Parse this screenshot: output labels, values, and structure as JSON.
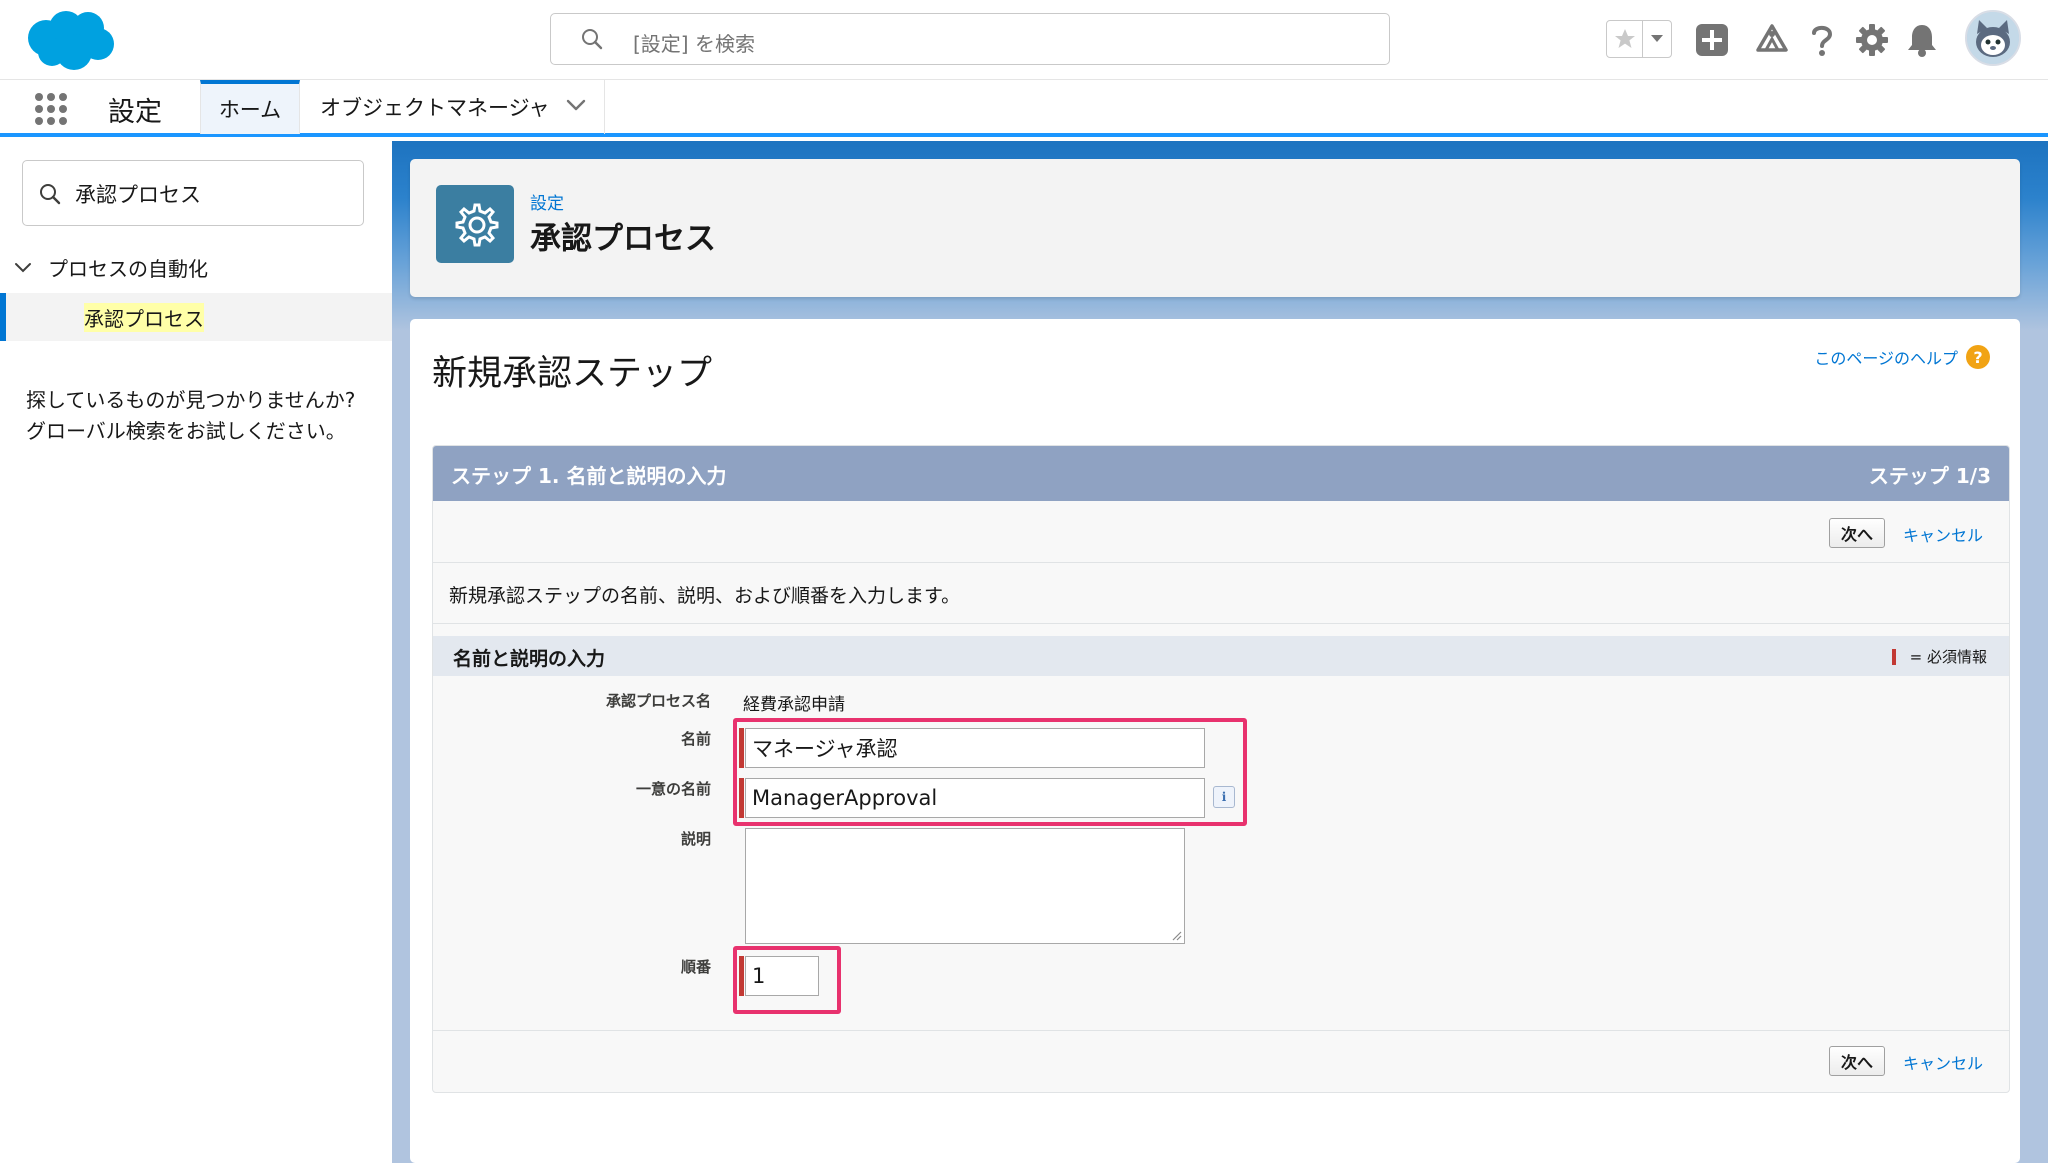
{
  "header": {
    "search_placeholder": "[設定] を検索",
    "brand_color": "#00a1e0"
  },
  "appnav": {
    "app_name": "設定",
    "tabs": [
      {
        "label": "ホーム"
      },
      {
        "label": "オブジェクトマネージャ"
      }
    ]
  },
  "sidebar": {
    "search_value": "承認プロセス",
    "group_label": "プロセスの自動化",
    "active_item": "承認プロセス",
    "help_line1": "探しているものが見つかりませんか?",
    "help_line2": "グローバル検索をお試しください。"
  },
  "page_header": {
    "breadcrumb": "設定",
    "title": "承認プロセス"
  },
  "content": {
    "page_title": "新規承認ステップ",
    "help_link": "このページのヘルプ",
    "step_title": "ステップ 1. 名前と説明の入力",
    "step_counter": "ステップ 1/3",
    "next_label": "次へ",
    "cancel_label": "キャンセル",
    "description": "新規承認ステップの名前、説明、および順番を入力します。",
    "section_title": "名前と説明の入力",
    "required_legend": "= 必須情報",
    "fields": {
      "process_name_label": "承認プロセス名",
      "process_name_value": "経費承認申請",
      "name_label": "名前",
      "name_value": "マネージャ承認",
      "unique_name_label": "一意の名前",
      "unique_name_value": "ManagerApproval",
      "description_label": "説明",
      "description_value": "",
      "order_label": "順番",
      "order_value": "1"
    }
  }
}
